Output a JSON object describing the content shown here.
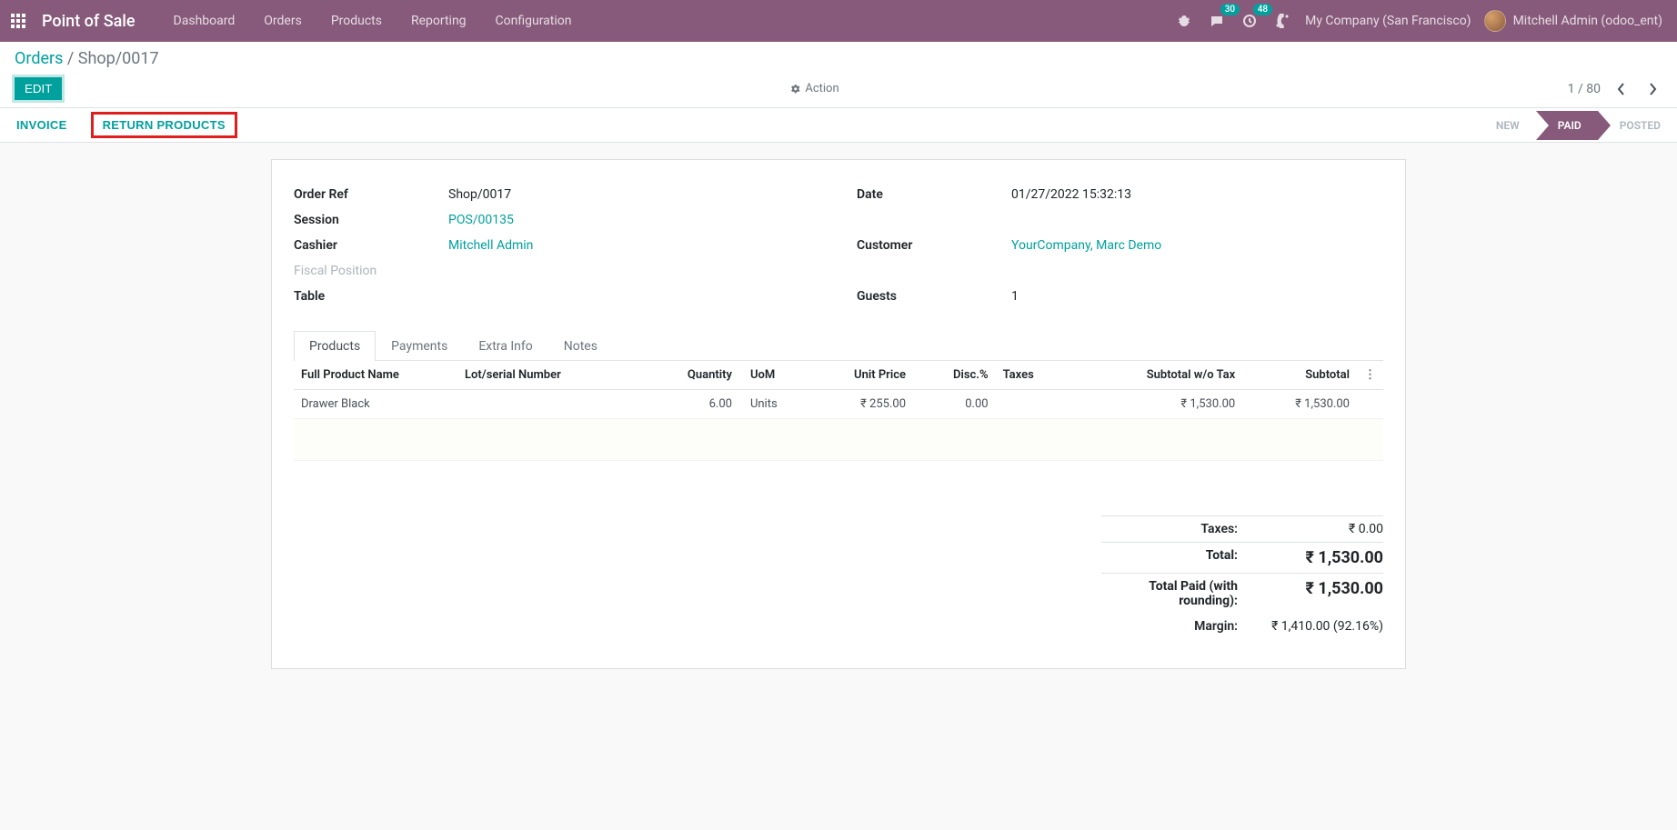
{
  "topnav": {
    "brand": "Point of Sale",
    "menu": [
      "Dashboard",
      "Orders",
      "Products",
      "Reporting",
      "Configuration"
    ],
    "messages_badge": "30",
    "activities_badge": "48",
    "company": "My Company (San Francisco)",
    "user": "Mitchell Admin (odoo_ent)"
  },
  "breadcrumb": {
    "root": "Orders",
    "current": "Shop/0017"
  },
  "controls": {
    "edit": "EDIT",
    "action": "Action",
    "pager": "1 / 80"
  },
  "statusbar": {
    "invoice": "INVOICE",
    "return_products": "RETURN PRODUCTS",
    "states": {
      "new": "NEW",
      "paid": "PAID",
      "posted": "POSTED"
    }
  },
  "fields_left": {
    "order_ref_label": "Order Ref",
    "order_ref": "Shop/0017",
    "session_label": "Session",
    "session": "POS/00135",
    "cashier_label": "Cashier",
    "cashier": "Mitchell Admin",
    "fiscal_label": "Fiscal Position",
    "fiscal": "",
    "table_label": "Table",
    "table": ""
  },
  "fields_right": {
    "date_label": "Date",
    "date": "01/27/2022 15:32:13",
    "customer_label": "Customer",
    "customer": "YourCompany, Marc Demo",
    "guests_label": "Guests",
    "guests": "1"
  },
  "tabs": {
    "products": "Products",
    "payments": "Payments",
    "extra": "Extra Info",
    "notes": "Notes"
  },
  "table": {
    "headers": {
      "name": "Full Product Name",
      "lot": "Lot/serial Number",
      "qty": "Quantity",
      "uom": "UoM",
      "price": "Unit Price",
      "disc": "Disc.%",
      "taxes": "Taxes",
      "subtotal_wo": "Subtotal w/o Tax",
      "subtotal": "Subtotal"
    },
    "rows": [
      {
        "name": "Drawer Black",
        "lot": "",
        "qty": "6.00",
        "uom": "Units",
        "price": "₹ 255.00",
        "disc": "0.00",
        "taxes": "",
        "subtotal_wo": "₹ 1,530.00",
        "subtotal": "₹ 1,530.00"
      }
    ]
  },
  "totals": {
    "taxes_label": "Taxes:",
    "taxes": "₹ 0.00",
    "total_label": "Total:",
    "total": "₹ 1,530.00",
    "paid_label": "Total Paid (with rounding):",
    "paid": "₹ 1,530.00",
    "margin_label": "Margin:",
    "margin": "₹ 1,410.00 (92.16%)"
  }
}
